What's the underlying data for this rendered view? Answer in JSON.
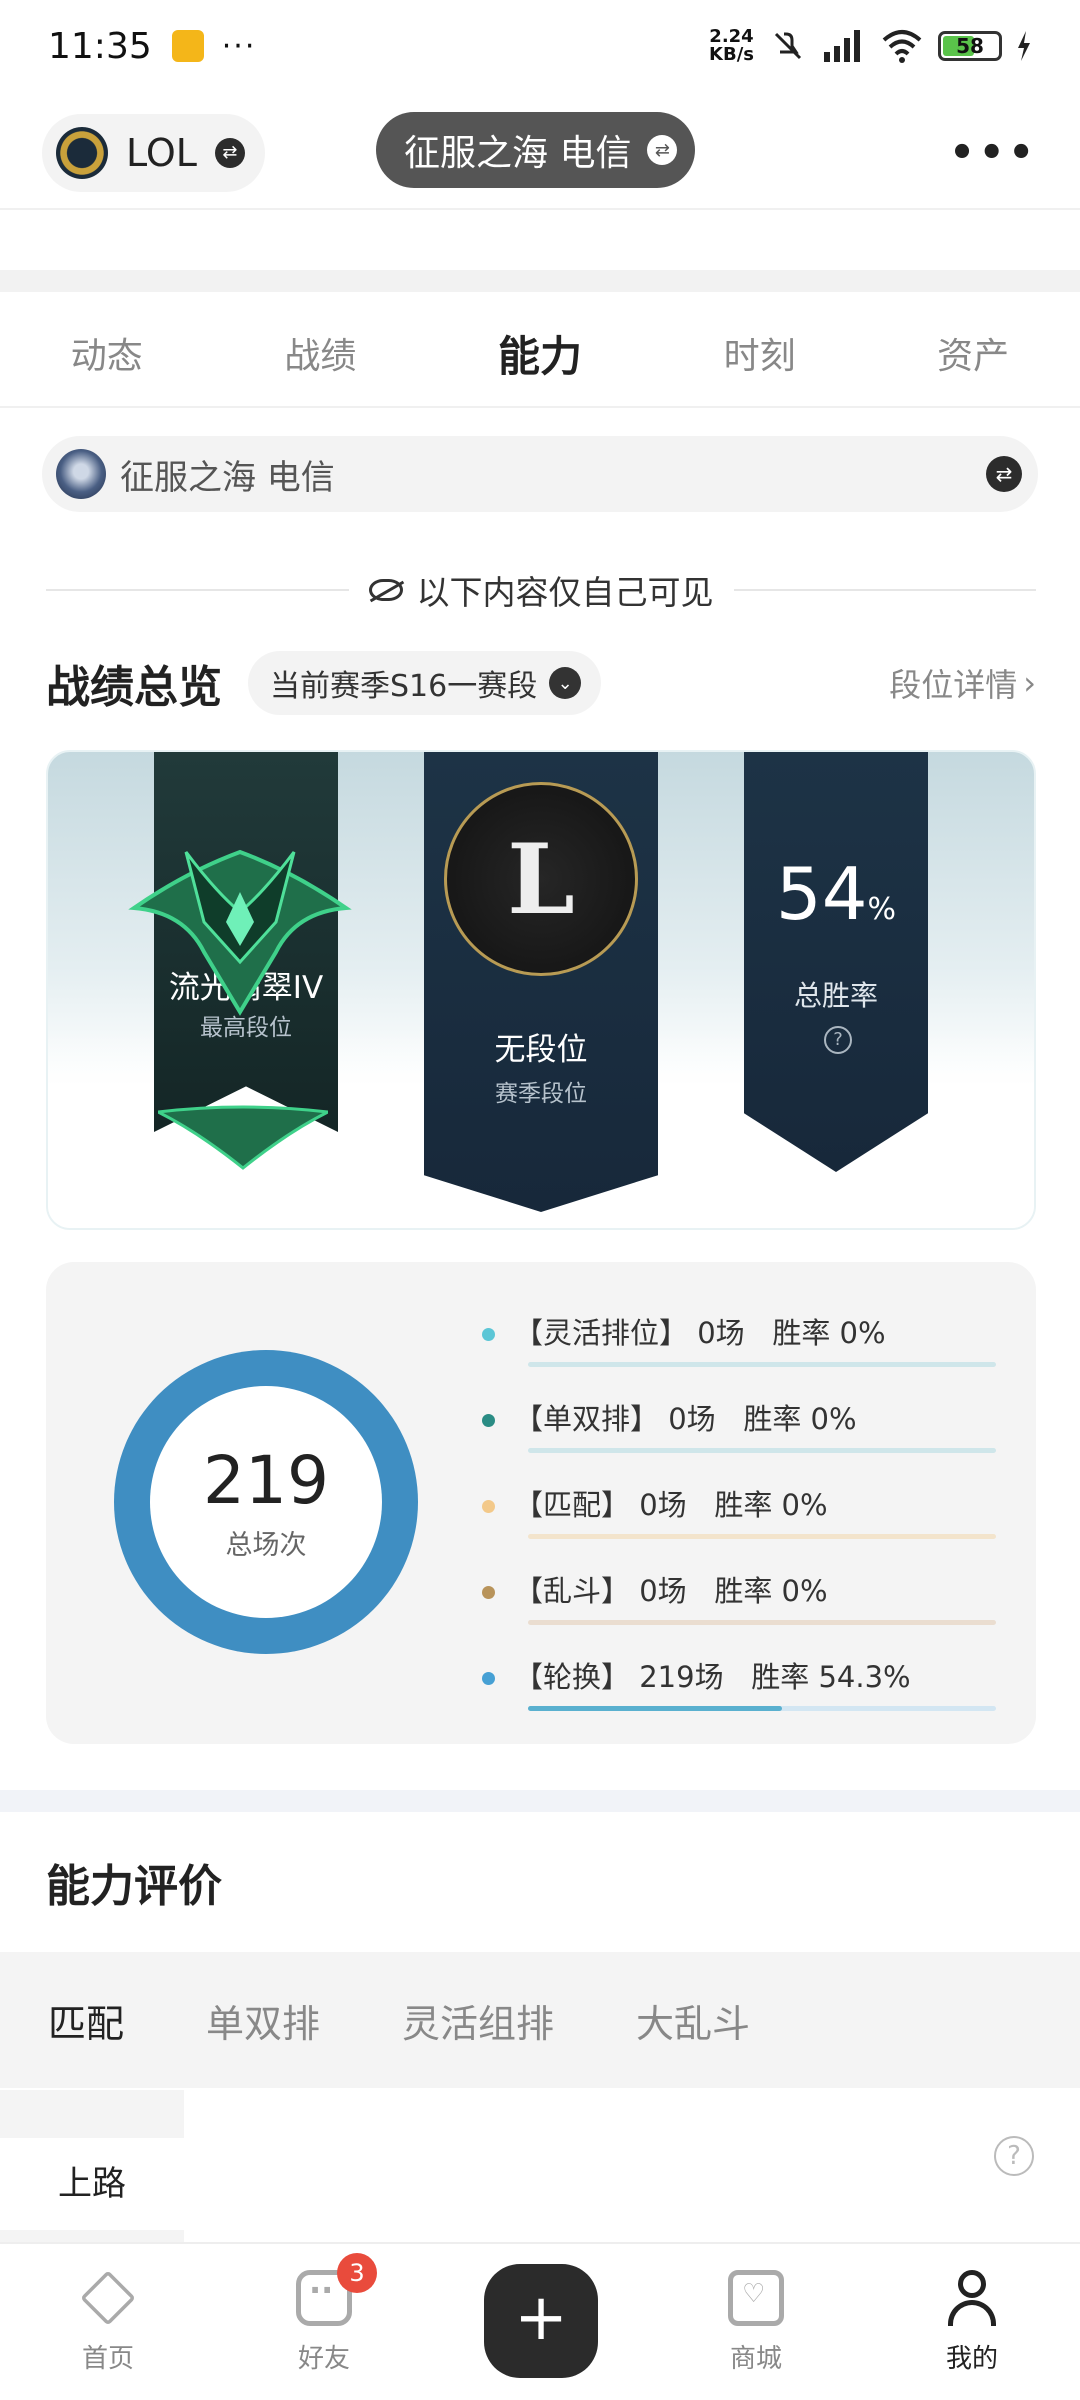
{
  "status_bar": {
    "time": "11:35",
    "dots": "···",
    "net_speed_value": "2.24",
    "net_speed_unit": "KB/s",
    "battery": "58"
  },
  "header": {
    "game": "LOL",
    "server": "征服之海 电信",
    "more": "•••"
  },
  "tabs": [
    "动态",
    "战绩",
    "能力",
    "时刻",
    "资产"
  ],
  "server_row": {
    "server": "征服之海 电信"
  },
  "privacy_text": "以下内容仅自己可见",
  "overview": {
    "title": "战绩总览",
    "season": "当前赛季S16一赛段",
    "detail_link": "段位详情"
  },
  "rank_card": {
    "highest_rank": "流光翡翠IV",
    "highest_rank_label": "最高段位",
    "season_rank": "无段位",
    "season_rank_label": "赛季段位",
    "emblem_letter": "L",
    "win_rate": "54",
    "win_rate_unit": "%",
    "win_rate_label": "总胜率",
    "help": "?"
  },
  "stats": {
    "total_games": "219",
    "total_label": "总场次",
    "modes": [
      {
        "text": "【灵活排位】 0场   胜率 0%",
        "dot_color": "#5cc6d6",
        "bar_color": "#cfe6ea",
        "fill_color": "#5cc6d6",
        "fill": 0
      },
      {
        "text": "【单双排】 0场   胜率 0%",
        "dot_color": "#2a8c84",
        "bar_color": "#cfe6ea",
        "fill_color": "#2a8c84",
        "fill": 0
      },
      {
        "text": "【匹配】 0场   胜率 0%",
        "dot_color": "#f3c98a",
        "bar_color": "#f3e4cc",
        "fill_color": "#f3c98a",
        "fill": 0
      },
      {
        "text": "【乱斗】 0场   胜率 0%",
        "dot_color": "#b8935a",
        "bar_color": "#eaddd0",
        "fill_color": "#b8935a",
        "fill": 0
      },
      {
        "text": "【轮换】 219场   胜率 54.3%",
        "dot_color": "#46a0d4",
        "bar_color": "#d3e6f2",
        "fill_color": "#5ab0cf",
        "fill": 0.543
      }
    ]
  },
  "ability": {
    "title": "能力评价",
    "tabs": [
      "匹配",
      "单双排",
      "灵活组排",
      "大乱斗"
    ],
    "lane": "上路",
    "help": "?"
  },
  "bottom_nav": {
    "items": [
      "首页",
      "好友",
      "商城",
      "我的"
    ],
    "badge": "3",
    "plus": "+"
  }
}
